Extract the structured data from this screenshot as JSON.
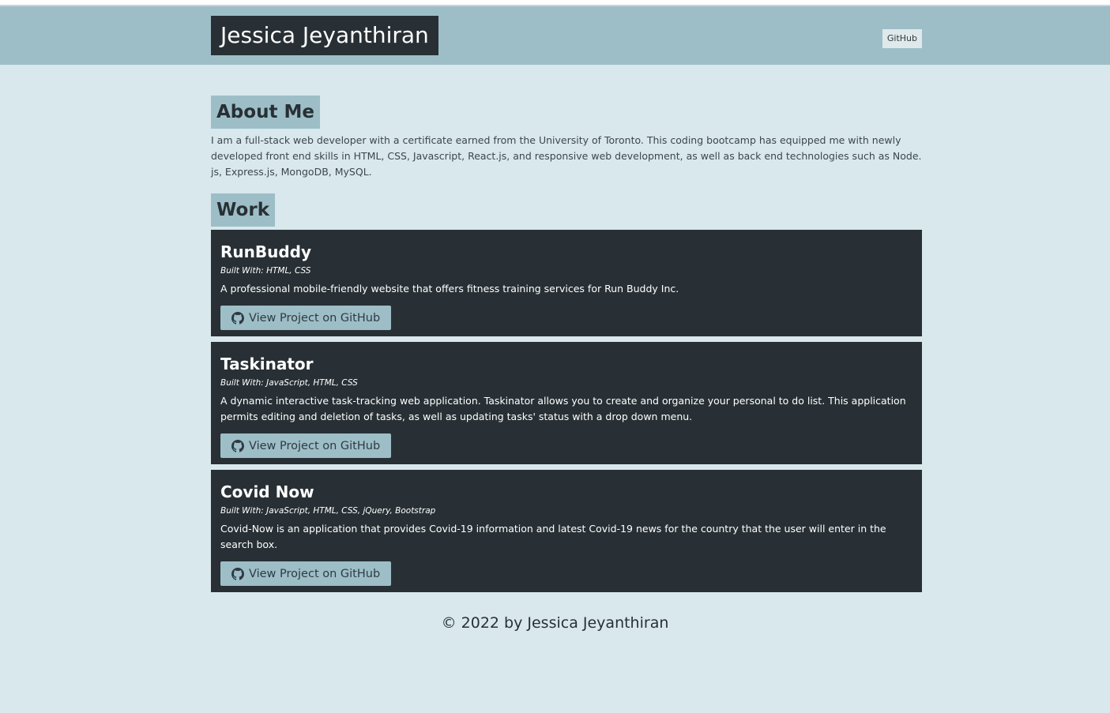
{
  "header": {
    "title": "Jessica Jeyanthiran",
    "nav_github_label": "GitHub"
  },
  "about": {
    "heading": "About Me",
    "text": "I am a full-stack web developer with a certificate earned from the University of Toronto. This coding bootcamp has equipped me with newly developed front end skills in HTML, CSS, Javascript, React.js, and responsive web development, as well as back end technologies such as Node. js, Express.js, MongoDB, MySQL."
  },
  "work": {
    "heading": "Work",
    "projects": [
      {
        "title": "RunBuddy",
        "built_with": "Built With: HTML, CSS",
        "description": "A professional mobile-friendly website that offers fitness training services for Run Buddy Inc.",
        "button_label": "View Project on GitHub",
        "icon": "github-icon"
      },
      {
        "title": "Taskinator",
        "built_with": "Built With: JavaScript, HTML, CSS",
        "description": "A dynamic interactive task-tracking web application. Taskinator allows you to create and organize your personal to do list. This application permits editing and deletion of tasks, as well as updating tasks' status with a drop down menu.",
        "button_label": "View Project on GitHub",
        "icon": "github-icon"
      },
      {
        "title": "Covid Now",
        "built_with": "Built With: JavaScript, HTML, CSS, jQuery, Bootstrap",
        "description": "Covid-Now is an application that provides Covid-19 information and latest Covid-19 news for the country that the user will enter in the search box.",
        "button_label": "View Project on GitHub",
        "icon": "github-icon"
      }
    ]
  },
  "footer": {
    "copyright": "© 2022 by Jessica Jeyanthiran"
  },
  "colors": {
    "page_background": "#d9e8ed",
    "accent": "#9dbec7",
    "dark": "#283035"
  }
}
